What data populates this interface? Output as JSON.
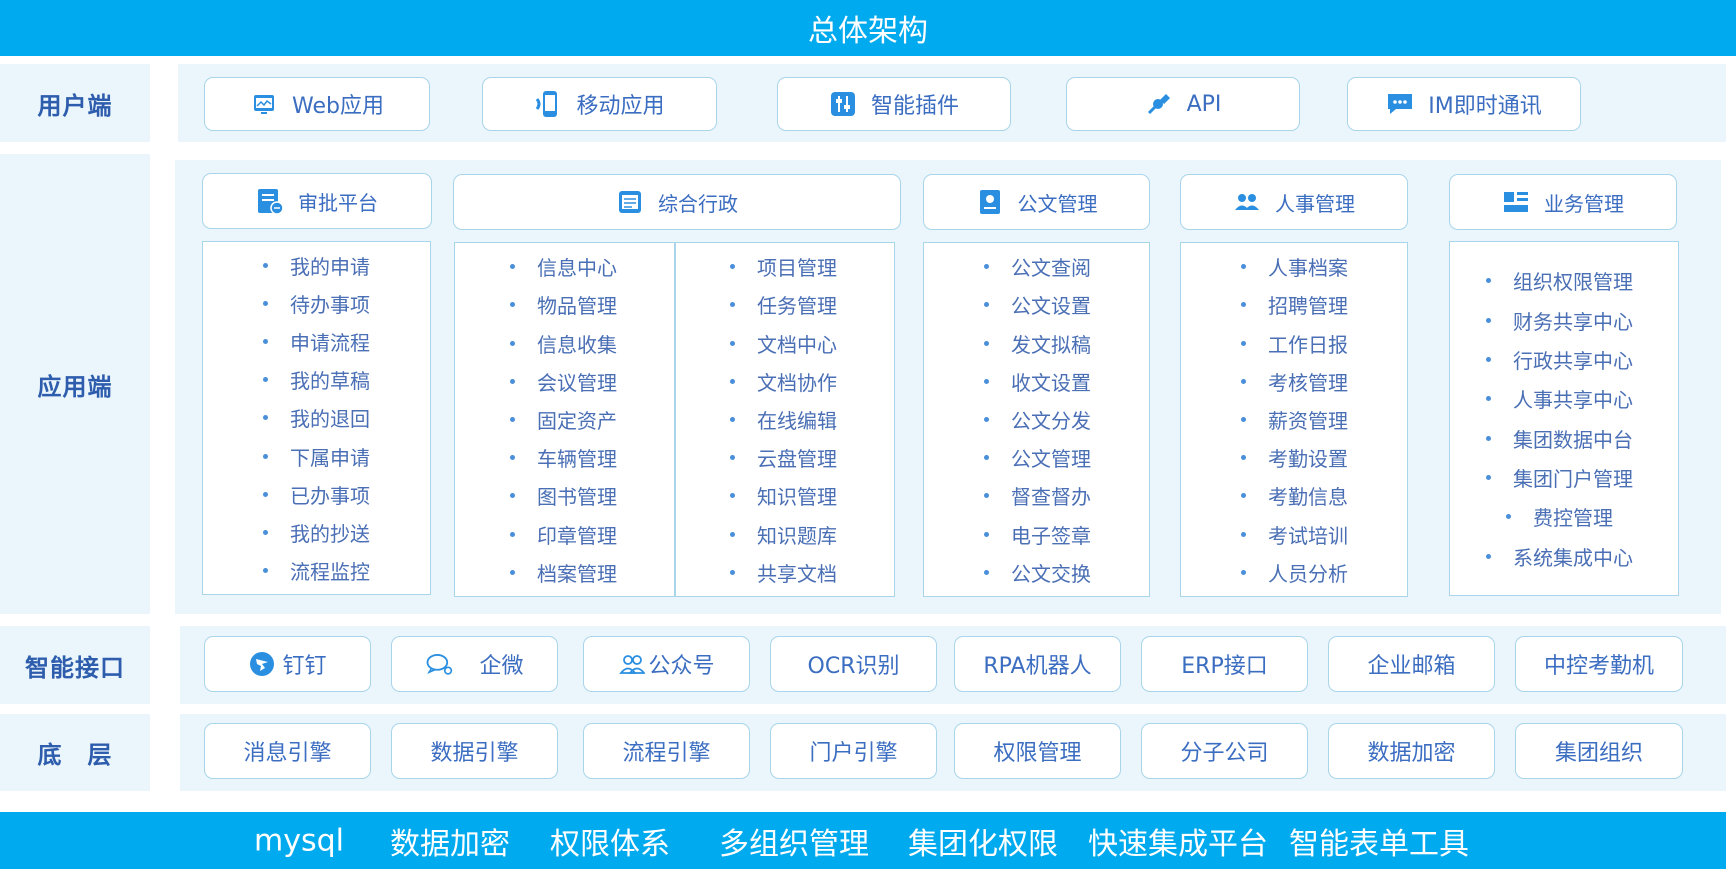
{
  "title": "总体架构",
  "rows": {
    "user": "用户端",
    "app": "应用端",
    "interface": "智能接口",
    "base": "底　层"
  },
  "user_items": [
    {
      "label": "Web应用",
      "icon": "web-monitor-icon"
    },
    {
      "label": "移动应用",
      "icon": "mobile-app-icon"
    },
    {
      "label": "智能插件",
      "icon": "plugin-sliders-icon"
    },
    {
      "label": "API",
      "icon": "api-plug-icon"
    },
    {
      "label": "IM即时通讯",
      "icon": "chat-bubble-icon"
    }
  ],
  "modules": [
    {
      "title": "审批平台",
      "icon": "approval-form-icon",
      "columns": [
        [
          "我的申请",
          "待办事项",
          "申请流程",
          "我的草稿",
          "我的退回",
          "下属申请",
          "已办事项",
          "我的抄送",
          "流程监控"
        ]
      ]
    },
    {
      "title": "综合行政",
      "icon": "admin-doc-icon",
      "columns": [
        [
          "信息中心",
          "物品管理",
          "信息收集",
          "会议管理",
          "固定资产",
          "车辆管理",
          "图书管理",
          "印章管理",
          "档案管理"
        ],
        [
          "项目管理",
          "任务管理",
          "文档中心",
          "文档协作",
          "在线编辑",
          "云盘管理",
          "知识管理",
          "知识题库",
          "共享文档"
        ]
      ]
    },
    {
      "title": "公文管理",
      "icon": "document-badge-icon",
      "columns": [
        [
          "公文查阅",
          "公文设置",
          "发文拟稿",
          "收文设置",
          "公文分发",
          "公文管理",
          "督查督办",
          "电子签章",
          "公文交换"
        ]
      ]
    },
    {
      "title": "人事管理",
      "icon": "people-group-icon",
      "columns": [
        [
          "人事档案",
          "招聘管理",
          "工作日报",
          "考核管理",
          "薪资管理",
          "考勤设置",
          "考勤信息",
          "考试培训",
          "人员分析"
        ]
      ]
    },
    {
      "title": "业务管理",
      "icon": "business-grid-icon",
      "columns": [
        [
          "组织权限管理",
          "财务共享中心",
          "行政共享中心",
          "人事共享中心",
          "集团数据中台",
          "集团门户管理",
          "费控管理",
          "系统集成中心"
        ]
      ]
    }
  ],
  "interfaces": [
    {
      "label": "钉钉",
      "icon": "dingtalk-icon"
    },
    {
      "label": "企微",
      "icon": "wecom-icon"
    },
    {
      "label": "公众号",
      "icon": "official-account-icon"
    },
    {
      "label": "OCR识别"
    },
    {
      "label": "RPA机器人"
    },
    {
      "label": "ERP接口"
    },
    {
      "label": "企业邮箱"
    },
    {
      "label": "中控考勤机"
    }
  ],
  "base_items": [
    "消息引擎",
    "数据引擎",
    "流程引擎",
    "门户引擎",
    "权限管理",
    "分子公司",
    "数据加密",
    "集团组织"
  ],
  "footer": [
    "mysql",
    "数据加密",
    "权限体系",
    "多组织管理",
    "集团化权限",
    "快速集成平台",
    "智能表单工具"
  ],
  "colors": {
    "primary": "#00aaee",
    "panel": "#eaf5fc",
    "border": "#a9d5ea",
    "text": "#3b6dc1",
    "label": "#2d5dac"
  }
}
